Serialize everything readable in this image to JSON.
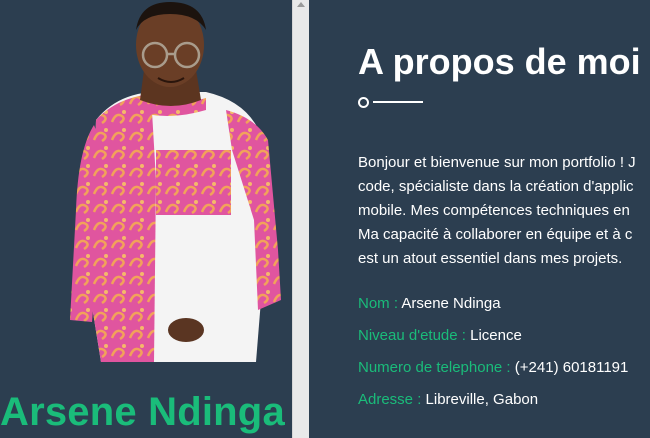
{
  "profile": {
    "name": "Arsene Ndinga"
  },
  "about": {
    "title": "A propos de moi",
    "bio_lines": [
      "Bonjour et bienvenue sur mon portfolio ! J",
      "code, spécialiste dans la création d'applic",
      "mobile. Mes compétences techniques en",
      "Ma capacité à collaborer en équipe et à c",
      "est un atout essentiel dans mes projets."
    ],
    "info": [
      {
        "label": "Nom : ",
        "value": "Arsene Ndinga"
      },
      {
        "label": "Niveau d'etude : ",
        "value": "Licence"
      },
      {
        "label": "Numero de telephone : ",
        "value": "(+241) 60181191"
      },
      {
        "label": "Adresse : ",
        "value": "Libreville, Gabon"
      }
    ]
  },
  "colors": {
    "background": "#2c3e50",
    "accent": "#1abc7a",
    "text": "#ffffff",
    "scrollbar": "#e9e9e9"
  }
}
